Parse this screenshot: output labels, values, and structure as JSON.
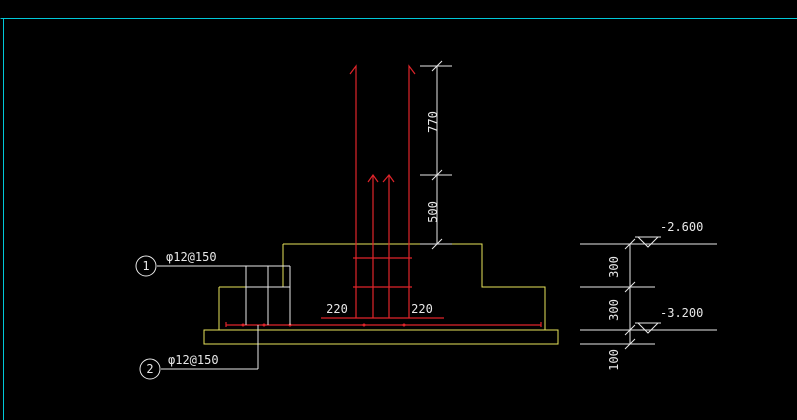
{
  "colors": {
    "background": "#000000",
    "frame": "#00c8d8",
    "concrete": "#e8e35a",
    "rebar": "#e0242a",
    "dimension": "#e8e8e8"
  },
  "labels": {
    "dim_770": "770",
    "dim_500": "500",
    "dim_300_upper": "300",
    "dim_300_lower": "300",
    "dim_100": "100",
    "dim_220_left": "220",
    "dim_220_right": "220",
    "level_top": "-2.600",
    "level_bottom": "-3.200",
    "callout_1_number": "1",
    "callout_1_text": "φ12@150",
    "callout_2_number": "2",
    "callout_2_text": "φ12@150"
  }
}
